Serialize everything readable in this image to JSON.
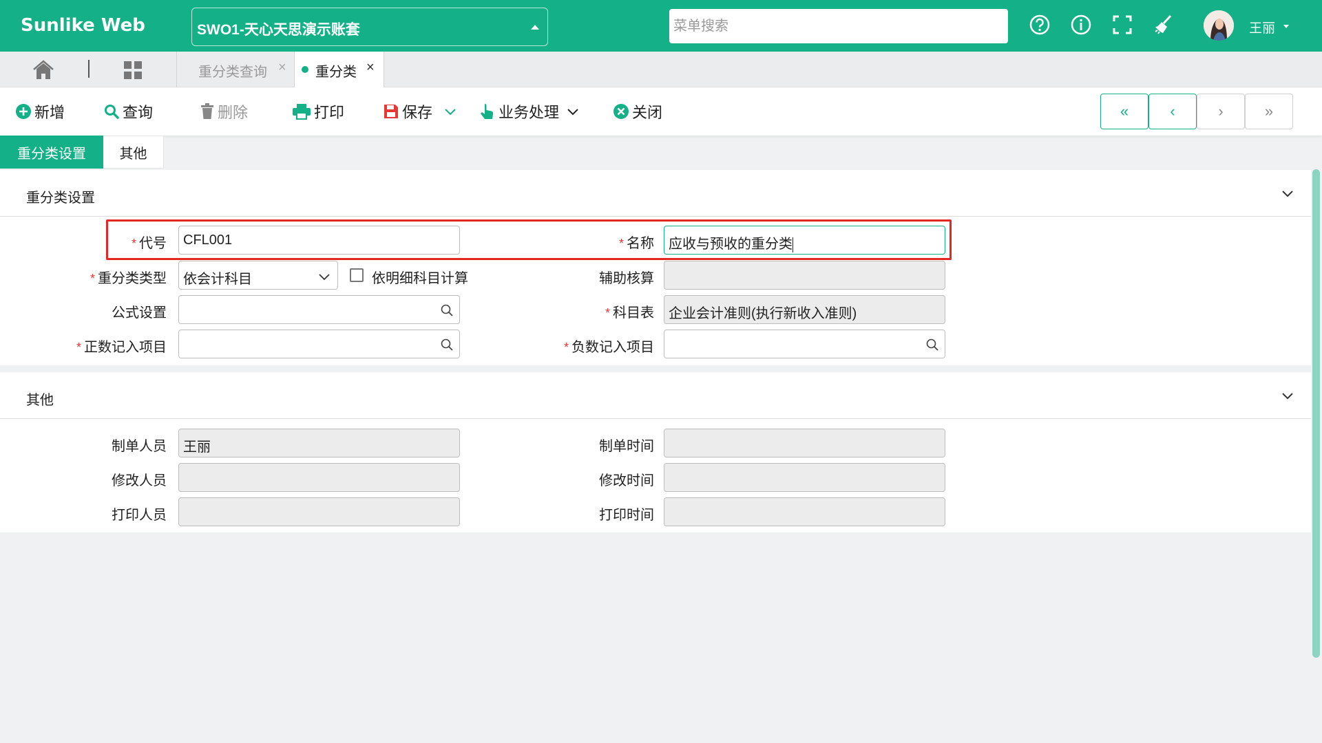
{
  "header": {
    "brand": "Sunlike Web",
    "account": "SWO1-天心天思演示账套",
    "search_placeholder": "菜单搜索",
    "user_name": "王丽",
    "icons": [
      "help-icon",
      "info-icon",
      "fullscreen-icon",
      "clean-icon"
    ]
  },
  "tabs": {
    "query_label": "重分类查询",
    "active_label": "重分类",
    "close_glyph": "×"
  },
  "toolbar": {
    "new": "新增",
    "query": "查询",
    "delete": "删除",
    "print": "打印",
    "save": "保存",
    "business": "业务处理",
    "close": "关闭",
    "nav": [
      "«",
      "‹",
      "›",
      "»"
    ]
  },
  "subtabs": [
    "重分类设置",
    "其他"
  ],
  "section1": {
    "title": "重分类设置",
    "code_label": "代号",
    "code_value": "CFL001",
    "name_label": "名称",
    "name_value": "应收与预收的重分类",
    "type_label": "重分类类型",
    "type_value": "依会计科目",
    "detail_checkbox_label": "依明细科目计算",
    "aux_label": "辅助核算",
    "aux_value": "",
    "formula_label": "公式设置",
    "formula_value": "",
    "chart_label": "科目表",
    "chart_value": "企业会计准则(执行新收入准则)",
    "positive_label": "正数记入项目",
    "positive_value": "",
    "negative_label": "负数记入项目",
    "negative_value": ""
  },
  "section2": {
    "title": "其他",
    "creator_label": "制单人员",
    "creator_value": "王丽",
    "create_time_label": "制单时间",
    "create_time_value": "",
    "modifier_label": "修改人员",
    "modifier_value": "",
    "modify_time_label": "修改时间",
    "modify_time_value": "",
    "printer_label": "打印人员",
    "printer_value": "",
    "print_time_label": "打印时间",
    "print_time_value": ""
  },
  "colors": {
    "accent": "#14b087",
    "required": "#e53935",
    "highlight": "#e32626"
  }
}
